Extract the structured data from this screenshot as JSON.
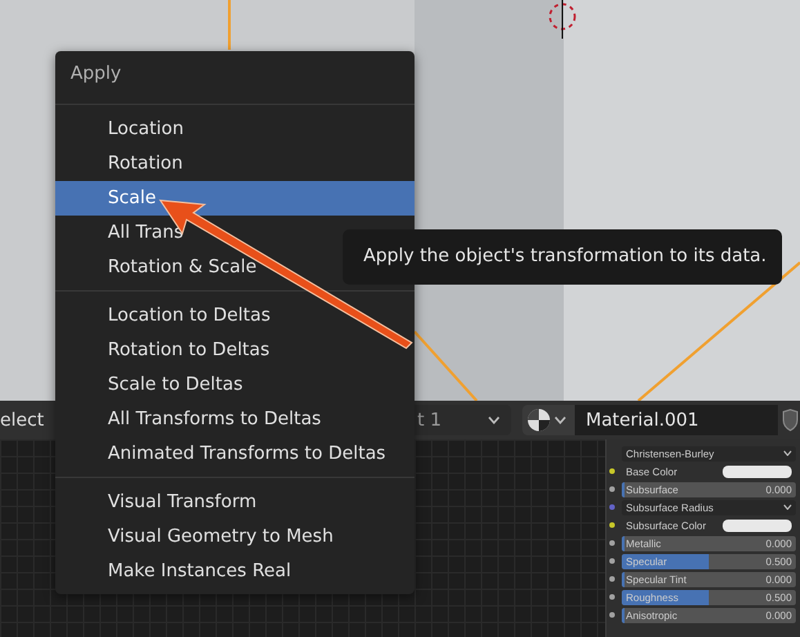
{
  "menu": {
    "title": "Apply",
    "groups": [
      {
        "items": [
          {
            "label": "Location",
            "selected": false
          },
          {
            "label": "Rotation",
            "selected": false
          },
          {
            "label": "Scale",
            "selected": true
          },
          {
            "label": "All Trans",
            "selected": false
          },
          {
            "label": "Rotation & Scale",
            "selected": false
          }
        ]
      },
      {
        "items": [
          {
            "label": "Location to Deltas",
            "selected": false
          },
          {
            "label": "Rotation to Deltas",
            "selected": false
          },
          {
            "label": "Scale to Deltas",
            "selected": false
          },
          {
            "label": "All Transforms to Deltas",
            "selected": false
          },
          {
            "label": "Animated Transforms to Deltas",
            "selected": false
          }
        ]
      },
      {
        "items": [
          {
            "label": "Visual Transform",
            "selected": false
          },
          {
            "label": "Visual Geometry to Mesh",
            "selected": false
          },
          {
            "label": "Make Instances Real",
            "selected": false
          }
        ]
      }
    ]
  },
  "tooltip": "Apply the object's transformation to its data.",
  "header": {
    "left_text": "elect",
    "slot": "t 1",
    "material": "Material.001"
  },
  "node_panel": {
    "rows": [
      {
        "kind": "dropdown",
        "label": "Christensen-Burley"
      },
      {
        "kind": "color",
        "label": "Base Color",
        "color": "#c7c729"
      },
      {
        "kind": "slider",
        "label": "Subsurface",
        "value": "0.000",
        "level": 0,
        "color": "#a1a1a1"
      },
      {
        "kind": "dropdown",
        "label": "Subsurface Radius",
        "color": "#6363c7"
      },
      {
        "kind": "color",
        "label": "Subsurface Color",
        "color": "#c7c729"
      },
      {
        "kind": "slider",
        "label": "Metallic",
        "value": "0.000",
        "level": 0,
        "color": "#a1a1a1"
      },
      {
        "kind": "slider",
        "label": "Specular",
        "value": "0.500",
        "level": 0.5,
        "color": "#a1a1a1"
      },
      {
        "kind": "slider",
        "label": "Specular Tint",
        "value": "0.000",
        "level": 0,
        "color": "#a1a1a1"
      },
      {
        "kind": "slider",
        "label": "Roughness",
        "value": "0.500",
        "level": 0.5,
        "color": "#a1a1a1"
      },
      {
        "kind": "slider",
        "label": "Anisotropic",
        "value": "0.000",
        "level": 0,
        "color": "#a1a1a1"
      }
    ]
  }
}
